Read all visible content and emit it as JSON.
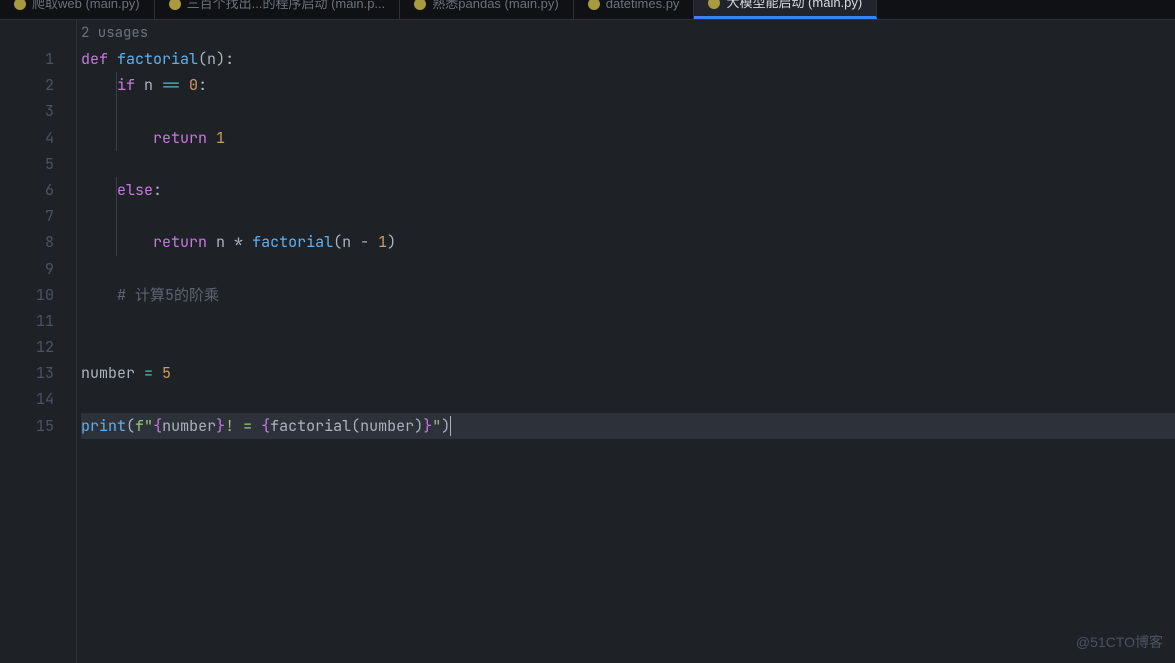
{
  "tabs": [
    {
      "label": "爬取web (main.py)",
      "active": false
    },
    {
      "label": "三百个找出...的程序启动 (main.p...",
      "active": false
    },
    {
      "label": "熟悉pandas (main.py)",
      "active": false
    },
    {
      "label": "datetimes.py",
      "active": false
    },
    {
      "label": "大模型能启动 (main.py)",
      "active": true
    }
  ],
  "usages_label": "2 usages",
  "line_count": 15,
  "current_line": 15,
  "code": {
    "l1": {
      "kw": "def ",
      "fn": "factorial",
      "p1": "(",
      "param": "n",
      "p2": ")",
      "colon": ":"
    },
    "l2": {
      "kw": "if ",
      "var": "n ",
      "op": "== ",
      "num": "0",
      "colon": ":"
    },
    "l4": {
      "kw": "return ",
      "num": "1"
    },
    "l6": {
      "kw": "else",
      "colon": ":"
    },
    "l8": {
      "kw": "return ",
      "var1": "n ",
      "op": "* ",
      "fn": "factorial",
      "p1": "(",
      "var2": "n ",
      "minus": "- ",
      "num": "1",
      "p2": ")"
    },
    "l10": {
      "cmt": "# 计算5的阶乘"
    },
    "l13": {
      "var": "number ",
      "op": "= ",
      "num": "5"
    },
    "l15": {
      "fn": "print",
      "p1": "(",
      "fpre": "f",
      "q1": "\"",
      "b1": "{",
      "v1": "number",
      "b2": "}",
      "s1": "! = ",
      "b3": "{",
      "fn2": "factorial",
      "p2": "(",
      "v2": "number",
      "p3": ")",
      "b4": "}",
      "q2": "\"",
      "p4": ")"
    }
  },
  "watermark": "@51CTO博客"
}
